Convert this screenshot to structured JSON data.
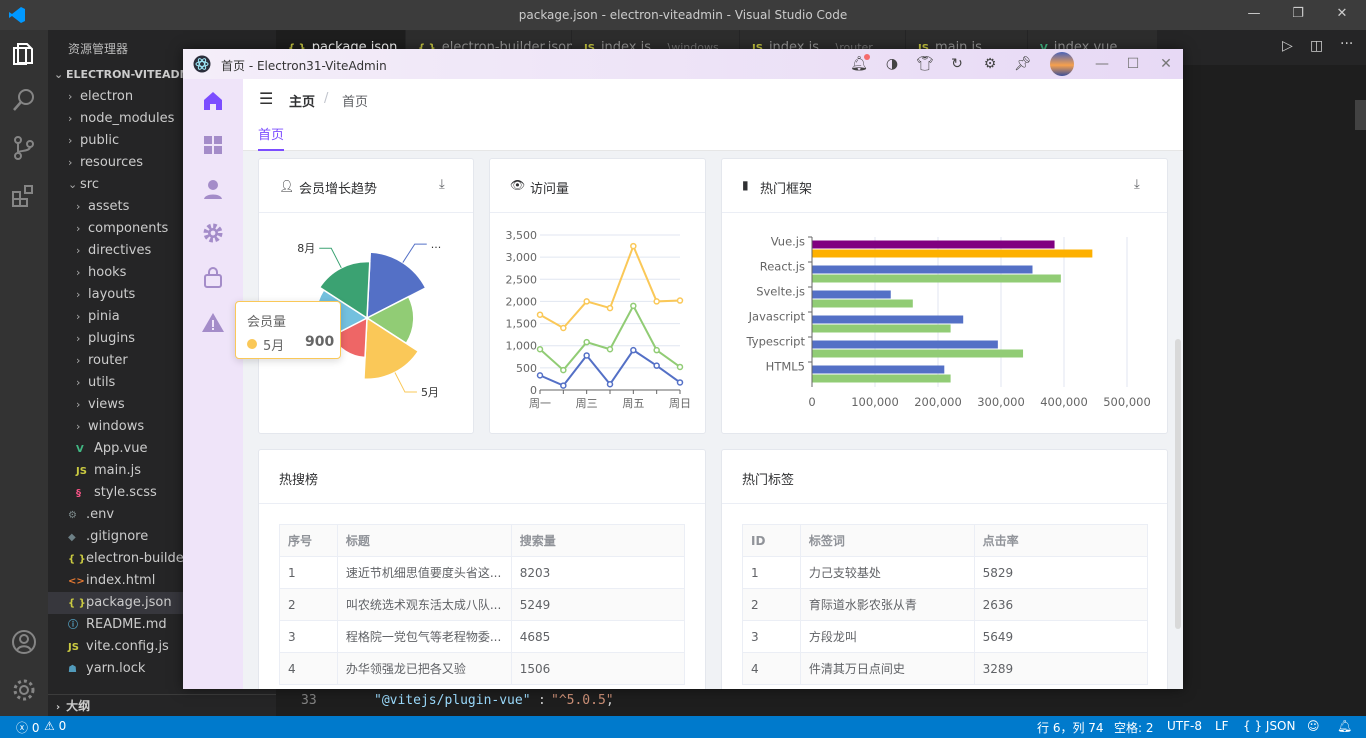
{
  "vscode": {
    "title": "package.json - electron-viteadmin - Visual Studio Code",
    "explorer_title": "资源管理器",
    "project": "ELECTRON-VITEADMIN",
    "tree": [
      {
        "label": "electron",
        "indent": 1,
        "type": "folder"
      },
      {
        "label": "node_modules",
        "indent": 1,
        "type": "folder"
      },
      {
        "label": "public",
        "indent": 1,
        "type": "folder"
      },
      {
        "label": "resources",
        "indent": 1,
        "type": "folder"
      },
      {
        "label": "src",
        "indent": 1,
        "type": "folder-open"
      },
      {
        "label": "assets",
        "indent": 2,
        "type": "folder"
      },
      {
        "label": "components",
        "indent": 2,
        "type": "folder"
      },
      {
        "label": "directives",
        "indent": 2,
        "type": "folder"
      },
      {
        "label": "hooks",
        "indent": 2,
        "type": "folder"
      },
      {
        "label": "layouts",
        "indent": 2,
        "type": "folder"
      },
      {
        "label": "pinia",
        "indent": 2,
        "type": "folder"
      },
      {
        "label": "plugins",
        "indent": 2,
        "type": "folder"
      },
      {
        "label": "router",
        "indent": 2,
        "type": "folder"
      },
      {
        "label": "utils",
        "indent": 2,
        "type": "folder"
      },
      {
        "label": "views",
        "indent": 2,
        "type": "folder"
      },
      {
        "label": "windows",
        "indent": 2,
        "type": "folder"
      },
      {
        "label": "App.vue",
        "indent": 2,
        "type": "vue"
      },
      {
        "label": "main.js",
        "indent": 2,
        "type": "js"
      },
      {
        "label": "style.scss",
        "indent": 2,
        "type": "scss"
      },
      {
        "label": ".env",
        "indent": 1,
        "type": "env"
      },
      {
        "label": ".gitignore",
        "indent": 1,
        "type": "git"
      },
      {
        "label": "electron-builder.json",
        "indent": 1,
        "type": "json"
      },
      {
        "label": "index.html",
        "indent": 1,
        "type": "html"
      },
      {
        "label": "package.json",
        "indent": 1,
        "type": "json",
        "selected": true
      },
      {
        "label": "README.md",
        "indent": 1,
        "type": "md"
      },
      {
        "label": "vite.config.js",
        "indent": 1,
        "type": "js"
      },
      {
        "label": "yarn.lock",
        "indent": 1,
        "type": "yarn"
      }
    ],
    "outline": "大纲",
    "tabs": [
      {
        "label": "package.json",
        "active": true,
        "icon": "{ }"
      },
      {
        "label": "electron-builder.json",
        "icon": "{ }"
      },
      {
        "label": "index.js",
        "desc": "...\\windows",
        "icon": "JS"
      },
      {
        "label": "index.js",
        "desc": "...\\router",
        "icon": "JS"
      },
      {
        "label": "main.js",
        "icon": "JS"
      },
      {
        "label": "index.vue",
        "icon": "V"
      }
    ],
    "code_line_no": "33",
    "code_key": "\"@vitejs/plugin-vue\"",
    "code_val": "\"^5.0.5\"",
    "status": {
      "errors": "0",
      "warnings": "0",
      "position": "行 6，列 74",
      "spaces": "空格: 2",
      "encoding": "UTF-8",
      "eol": "LF",
      "language": "{ } JSON"
    }
  },
  "app": {
    "title": "首页 - Electron31-ViteAdmin",
    "breadcrumb_home": "主页",
    "breadcrumb_sep": "/",
    "breadcrumb_current": "首页",
    "tab": "首页",
    "cards": {
      "members": "会员增长趋势",
      "visits": "访问量",
      "frameworks": "热门框架",
      "hotsearch": "热搜榜",
      "hottags": "热门标签"
    },
    "tooltip": {
      "title": "会员量",
      "label": "5月",
      "value": "900"
    },
    "hot_search": {
      "columns": [
        "序号",
        "标题",
        "搜索量"
      ],
      "rows": [
        [
          "1",
          "速近节机细思值要度头省这...",
          "8203"
        ],
        [
          "2",
          "叫农统选术观东活太成八队...",
          "5249"
        ],
        [
          "3",
          "程格院一党包气等老程物委...",
          "4685"
        ],
        [
          "4",
          "办华领强龙已把各又验",
          "1506"
        ]
      ]
    },
    "hot_tags": {
      "columns": [
        "ID",
        "标签词",
        "点击率"
      ],
      "rows": [
        [
          "1",
          "力己支较基处",
          "5829"
        ],
        [
          "2",
          "育际道水影农张从青",
          "2636"
        ],
        [
          "3",
          "方段龙叫",
          "5649"
        ],
        [
          "4",
          "件清其万日点间史",
          "3289"
        ]
      ]
    }
  },
  "chart_data": [
    {
      "type": "pie",
      "title": "会员增长趋势",
      "rose": true,
      "labels_visible": [
        "8月",
        "...",
        "5月"
      ],
      "slices": [
        {
          "label": "...",
          "value": 1000,
          "color": "#5470c6"
        },
        {
          "label": "",
          "value": 600,
          "color": "#91cc75"
        },
        {
          "label": "5月",
          "value": 900,
          "color": "#fac858"
        },
        {
          "label": "",
          "value": 450,
          "color": "#ee6666"
        },
        {
          "label": "",
          "value": 700,
          "color": "#73c0de"
        },
        {
          "label": "8月",
          "value": 800,
          "color": "#3ba272"
        }
      ]
    },
    {
      "type": "line",
      "title": "访问量",
      "categories": [
        "周一",
        "",
        "周三",
        "",
        "周五",
        "",
        "周日"
      ],
      "x_tick_labels": [
        "周一",
        "周三",
        "周五",
        "周日"
      ],
      "yticks": [
        "0",
        "500",
        "1,000",
        "1,500",
        "2,000",
        "2,500",
        "3,000",
        "3,500"
      ],
      "ylim": [
        0,
        3500
      ],
      "series": [
        {
          "color": "#fac858",
          "values": [
            1700,
            1400,
            2000,
            1850,
            3250,
            2000,
            2020
          ]
        },
        {
          "color": "#91cc75",
          "values": [
            920,
            450,
            1080,
            920,
            1900,
            900,
            520
          ]
        },
        {
          "color": "#5470c6",
          "values": [
            330,
            100,
            780,
            130,
            900,
            550,
            170
          ]
        }
      ]
    },
    {
      "type": "bar",
      "orientation": "horizontal",
      "title": "热门框架",
      "categories": [
        "Vue.js",
        "React.js",
        "Svelte.js",
        "Javascript",
        "Typescript",
        "HTML5"
      ],
      "xticks": [
        "0",
        "100,000",
        "200,000",
        "300,000",
        "400,000",
        "500,000"
      ],
      "xlim": [
        0,
        500000
      ],
      "series": [
        {
          "color": "#800080",
          "values": [
            385000,
            350000,
            125000,
            240000,
            295000,
            210000
          ]
        },
        {
          "color": "#fdb000",
          "values": [
            445000,
            395000,
            160000,
            220000,
            335000,
            220000
          ]
        }
      ]
    }
  ]
}
